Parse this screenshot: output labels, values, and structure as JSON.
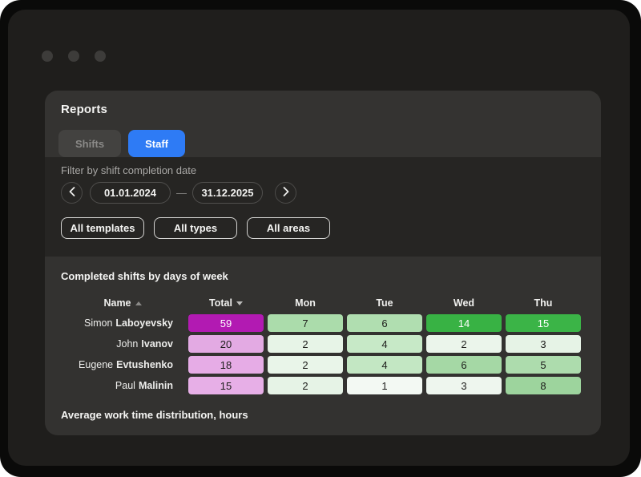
{
  "colors": {
    "accent_blue": "#2e7bf5",
    "magenta_strong": "#b21ab2",
    "green_strong": "#3ab446",
    "window_bg": "#1f1e1c",
    "panel_header_bg": "#343331",
    "panel_filter_bg": "#262523",
    "panel_table_bg": "#333230"
  },
  "reports": {
    "title": "Reports",
    "tabs": [
      {
        "label": "Shifts",
        "active": false
      },
      {
        "label": "Staff",
        "active": true
      }
    ],
    "filter": {
      "label": "Filter by shift completion date",
      "date_from": "01.01.2024",
      "separator": "—",
      "date_to": "31.12.2025",
      "dropdowns": [
        "All templates",
        "All types",
        "All areas"
      ]
    },
    "table": {
      "title": "Completed shifts by days of week",
      "columns": [
        "Name",
        "Total",
        "Mon",
        "Tue",
        "Wed",
        "Thu"
      ],
      "sort": {
        "name": "asc",
        "total": "desc"
      },
      "rows": [
        {
          "first": "Simon",
          "last": "Laboyevsky",
          "cells": [
            {
              "v": "59",
              "style": "background:#b21ab2;color:#ffffff"
            },
            {
              "v": "7",
              "style": "background:#abdcab;color:#1d1d1b"
            },
            {
              "v": "6",
              "style": "background:#b0deb0;color:#1d1d1b"
            },
            {
              "v": "14",
              "style": "background:#38b244;color:#ffffff"
            },
            {
              "v": "15",
              "style": "background:#3bb447;color:#ffffff"
            }
          ]
        },
        {
          "first": "John",
          "last": "Ivanov",
          "cells": [
            {
              "v": "20",
              "style": "background:#e3aae3;color:#1d1d1b"
            },
            {
              "v": "2",
              "style": "background:#e7f4e7;color:#1d1d1b"
            },
            {
              "v": "4",
              "style": "background:#c7e9c7;color:#1d1d1b"
            },
            {
              "v": "2",
              "style": "background:#ebf5eb;color:#1d1d1b"
            },
            {
              "v": "3",
              "style": "background:#e6f3e6;color:#1d1d1b"
            }
          ]
        },
        {
          "first": "Eugene",
          "last": "Evtushenko",
          "cells": [
            {
              "v": "18",
              "style": "background:#e6ace6;color:#1d1d1b"
            },
            {
              "v": "2",
              "style": "background:#e9f5e9;color:#1d1d1b"
            },
            {
              "v": "4",
              "style": "background:#c3e7c3;color:#1d1d1b"
            },
            {
              "v": "6",
              "style": "background:#a5d8a5;color:#1d1d1b"
            },
            {
              "v": "5",
              "style": "background:#addcad;color:#1d1d1b"
            }
          ]
        },
        {
          "first": "Paul",
          "last": "Malinin",
          "cells": [
            {
              "v": "15",
              "style": "background:#e7afe7;color:#1d1d1b"
            },
            {
              "v": "2",
              "style": "background:#e6f3e6;color:#1d1d1b"
            },
            {
              "v": "1",
              "style": "background:#f3f9f3;color:#1d1d1b"
            },
            {
              "v": "3",
              "style": "background:#eef6ee;color:#1d1d1b"
            },
            {
              "v": "8",
              "style": "background:#9dd49d;color:#1d1d1b"
            }
          ]
        }
      ]
    },
    "footer_title": "Average work time distribution, hours"
  }
}
